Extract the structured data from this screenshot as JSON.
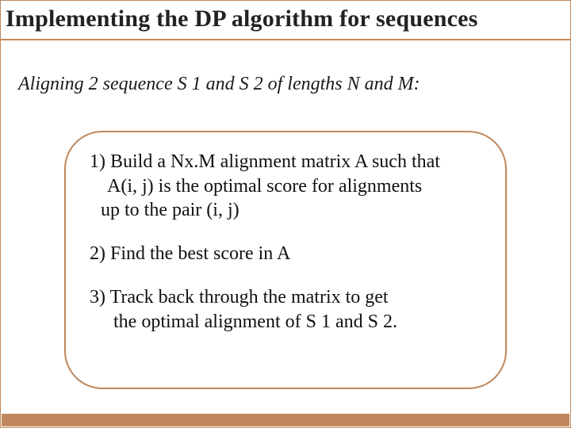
{
  "title": "Implementing the DP algorithm for sequences",
  "subtitle": "Aligning 2 sequence S 1 and S 2 of lengths N and M:",
  "steps": {
    "s1": {
      "l1": "1) Build a Nx.M alignment matrix A such that",
      "l2": "A(i, j) is the optimal score for alignments",
      "l3": "up to the pair (i, j)"
    },
    "s2": {
      "l1": "2) Find the best score in A"
    },
    "s3": {
      "l1": "3) Track back through the matrix to get",
      "l2": "the optimal alignment of S 1 and S 2."
    }
  }
}
